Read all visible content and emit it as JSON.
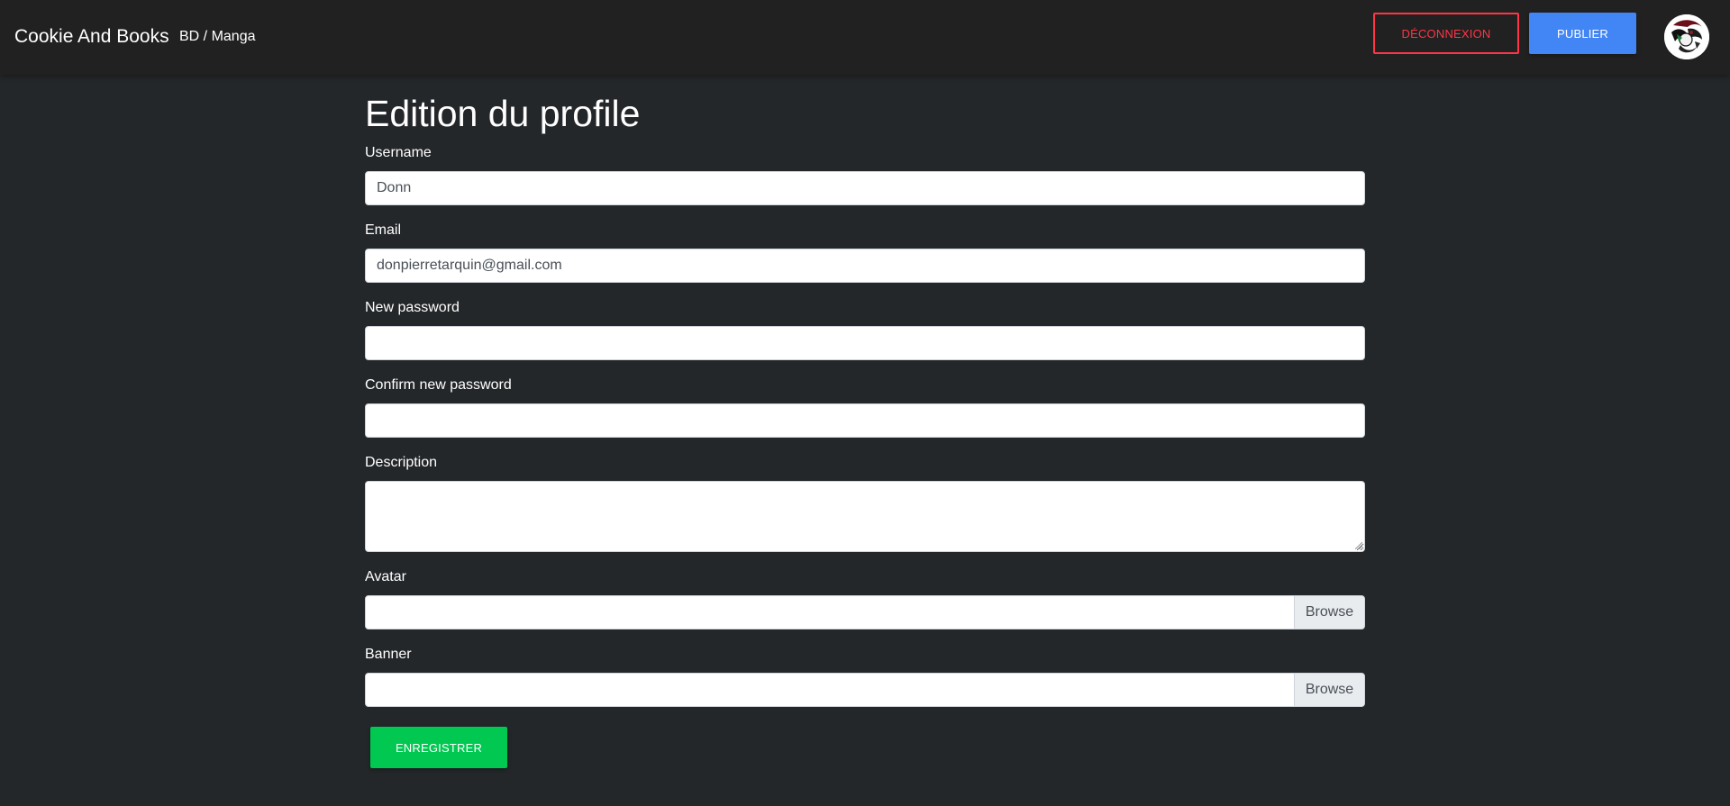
{
  "navbar": {
    "brand": "Cookie And Books",
    "link": "BD / Manga",
    "logout_label": "DÉCONNEXION",
    "publish_label": "PUBLIER"
  },
  "form": {
    "title": "Edition du profile",
    "username": {
      "label": "Username",
      "value": "Donn"
    },
    "email": {
      "label": "Email",
      "value": "donpierretarquin@gmail.com"
    },
    "new_password": {
      "label": "New password",
      "value": ""
    },
    "confirm_password": {
      "label": "Confirm new password",
      "value": ""
    },
    "description": {
      "label": "Description",
      "value": ""
    },
    "avatar": {
      "label": "Avatar",
      "browse_label": "Browse"
    },
    "banner": {
      "label": "Banner",
      "browse_label": "Browse"
    },
    "save_label": "ENREGISTRER"
  },
  "colors": {
    "background": "#24272a",
    "navbar": "#212121",
    "danger": "#ff3547",
    "primary": "#4285f4",
    "success": "#00c851"
  },
  "icons": {
    "avatar": "user-avatar-image"
  }
}
